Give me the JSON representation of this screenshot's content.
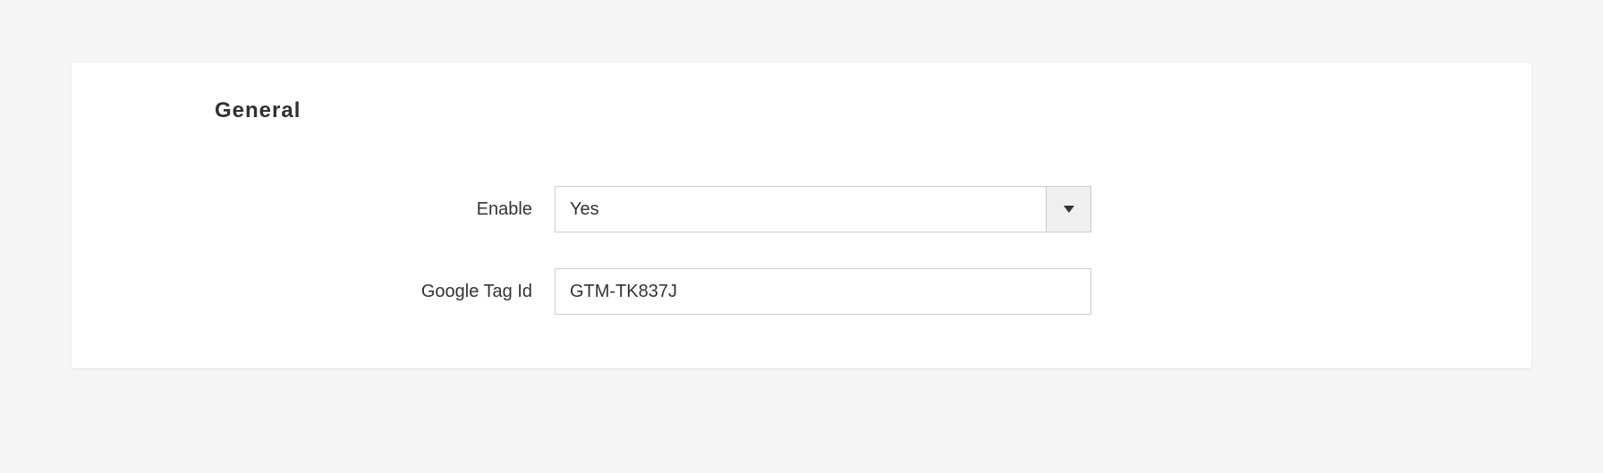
{
  "section": {
    "title": "General",
    "fields": {
      "enable": {
        "label": "Enable",
        "value": "Yes"
      },
      "google_tag_id": {
        "label": "Google Tag Id",
        "value": "GTM-TK837J"
      }
    }
  }
}
